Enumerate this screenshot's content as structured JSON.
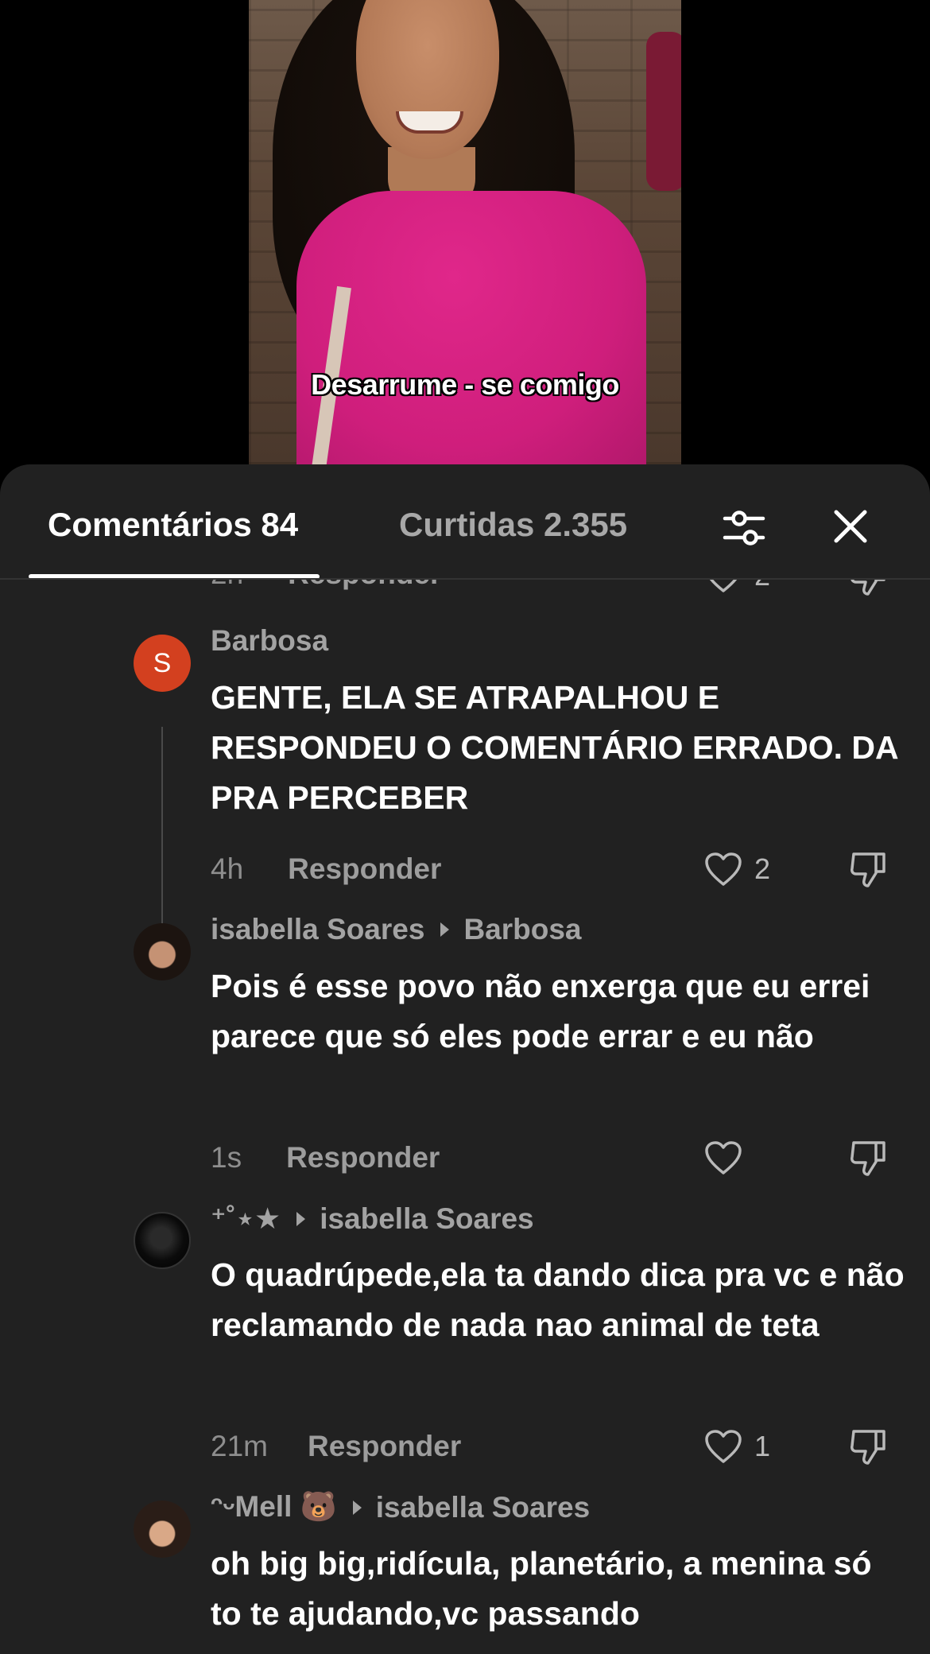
{
  "video": {
    "caption": "Desarrume - se comigo"
  },
  "tabs": {
    "comments_label": "Comentários 84",
    "likes_label": "Curtidas 2.355",
    "filter_icon": "sliders-icon",
    "close_icon": "close-icon"
  },
  "partial_row": {
    "time": "2h",
    "reply_label": "Responder",
    "like_count": "2"
  },
  "comments": [
    {
      "author": "Barbosa",
      "avatar_letter": "S",
      "text": "GENTE, ELA SE ATRAPALHOU E RESPONDEU O COMENTÁRIO ERRADO. DA PRA PERCEBER",
      "time": "4h",
      "reply_label": "Responder",
      "like_count": "2"
    },
    {
      "author": "isabella Soares",
      "reply_to": "Barbosa",
      "text": "Pois é esse povo não enxerga que eu errei parece que só eles pode errar e eu não",
      "time": "1s",
      "reply_label": "Responder",
      "like_count": ""
    },
    {
      "author": "⁺˚⋆★",
      "reply_to": "isabella Soares",
      "text": "O quadrúpede,ela ta dando dica pra vc e não reclamando de nada nao animal de teta",
      "time": "21m",
      "reply_label": "Responder",
      "like_count": "1"
    },
    {
      "author": "ᵔᵕMell 🐻",
      "reply_to": "isabella Soares",
      "text": "oh big big,ridícula, planetário, a menina só to te ajudando,vc passando",
      "time": "",
      "reply_label": "",
      "like_count": ""
    }
  ]
}
